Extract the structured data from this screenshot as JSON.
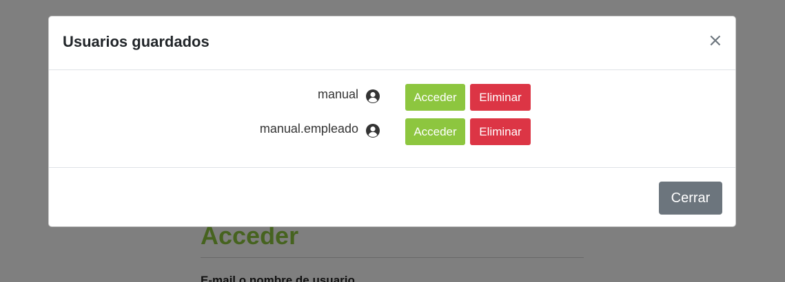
{
  "background": {
    "heading": "Acceder",
    "field_label": "E-mail o nombre de usuario"
  },
  "modal": {
    "title": "Usuarios guardados",
    "close_symbol": "×",
    "users": [
      {
        "name": "manual",
        "icon": "user-circle-icon",
        "access_label": "Acceder",
        "delete_label": "Eliminar"
      },
      {
        "name": "manual.empleado",
        "icon": "user-circle-icon",
        "access_label": "Acceder",
        "delete_label": "Eliminar"
      }
    ],
    "close_button_label": "Cerrar"
  },
  "colors": {
    "accent_green": "#8dc63f",
    "danger_red": "#dc3545",
    "secondary_gray": "#6c757d",
    "overlay": "rgba(0,0,0,0.5)"
  }
}
